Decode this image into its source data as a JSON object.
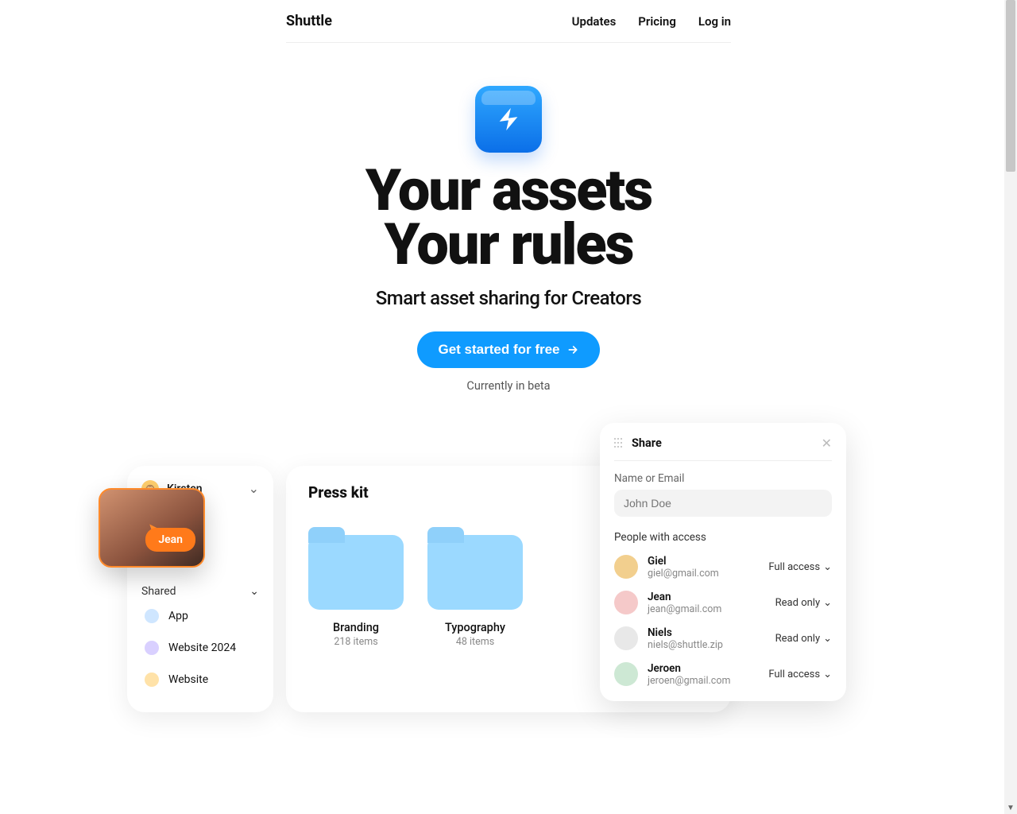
{
  "nav": {
    "brand": "Shuttle",
    "updates": "Updates",
    "pricing": "Pricing",
    "login": "Log in"
  },
  "hero": {
    "headline1": "Your assets",
    "headline2": "Your rules",
    "tagline": "Smart asset sharing for Creators",
    "cta": "Get started for free",
    "beta": "Currently in beta"
  },
  "sidebar": {
    "user": "Kirsten",
    "jean_label": "Jean",
    "shared_label": "Shared",
    "items": [
      {
        "label": "App"
      },
      {
        "label": "Website 2024"
      },
      {
        "label": "Website"
      }
    ]
  },
  "main": {
    "title": "Press kit",
    "folders": [
      {
        "name": "Branding",
        "count": "218 items"
      },
      {
        "name": "Typography",
        "count": "48 items"
      }
    ]
  },
  "share": {
    "title": "Share",
    "label": "Name or Email",
    "placeholder": "John Doe",
    "people_label": "People with access",
    "people": [
      {
        "name": "Giel",
        "email": "giel@gmail.com",
        "access": "Full access"
      },
      {
        "name": "Jean",
        "email": "jean@gmail.com",
        "access": "Read only"
      },
      {
        "name": "Niels",
        "email": "niels@shuttle.zip",
        "access": "Read only"
      },
      {
        "name": "Jeroen",
        "email": "jeroen@gmail.com",
        "access": "Full access"
      }
    ]
  }
}
